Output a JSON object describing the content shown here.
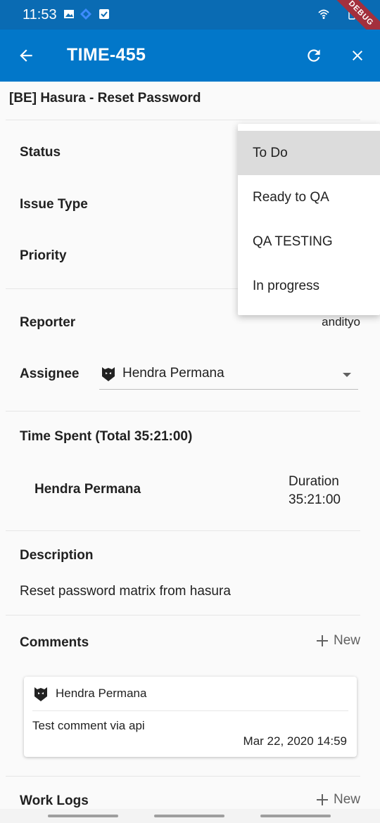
{
  "status_bar": {
    "time": "11:53",
    "icons": [
      "gallery-icon",
      "diamond-app-icon",
      "checkbox-app-icon",
      "wifi-icon",
      "battery-icon"
    ],
    "debug_banner": "DEBUG"
  },
  "app_bar": {
    "title": "TIME-455",
    "back_icon": "arrow-left-icon",
    "refresh_icon": "refresh-icon",
    "close_icon": "close-icon",
    "color": "#0277c9"
  },
  "task": {
    "title": "[BE] Hasura - Reset Password",
    "labels": {
      "status": "Status",
      "issue_type": "Issue Type",
      "priority": "Priority",
      "reporter": "Reporter",
      "assignee": "Assignee"
    },
    "reporter_value": "andityo",
    "assignee_value": "Hendra Permana"
  },
  "status_dropdown": {
    "options": [
      "To Do",
      "Ready to QA",
      "QA TESTING",
      "In progress"
    ],
    "selected": "To Do"
  },
  "time_spent": {
    "heading": "Time Spent (Total 35:21:00)",
    "entries": [
      {
        "user": "Hendra Permana",
        "duration_label": "Duration",
        "duration": "35:21:00"
      }
    ]
  },
  "description": {
    "heading": "Description",
    "text": "Reset password matrix from hasura"
  },
  "comments": {
    "heading": "Comments",
    "new_label": "New",
    "items": [
      {
        "author": "Hendra Permana",
        "text": "Test comment via api",
        "date": "Mar 22, 2020  14:59"
      }
    ]
  },
  "work_logs": {
    "heading": "Work Logs",
    "new_label": "New"
  }
}
